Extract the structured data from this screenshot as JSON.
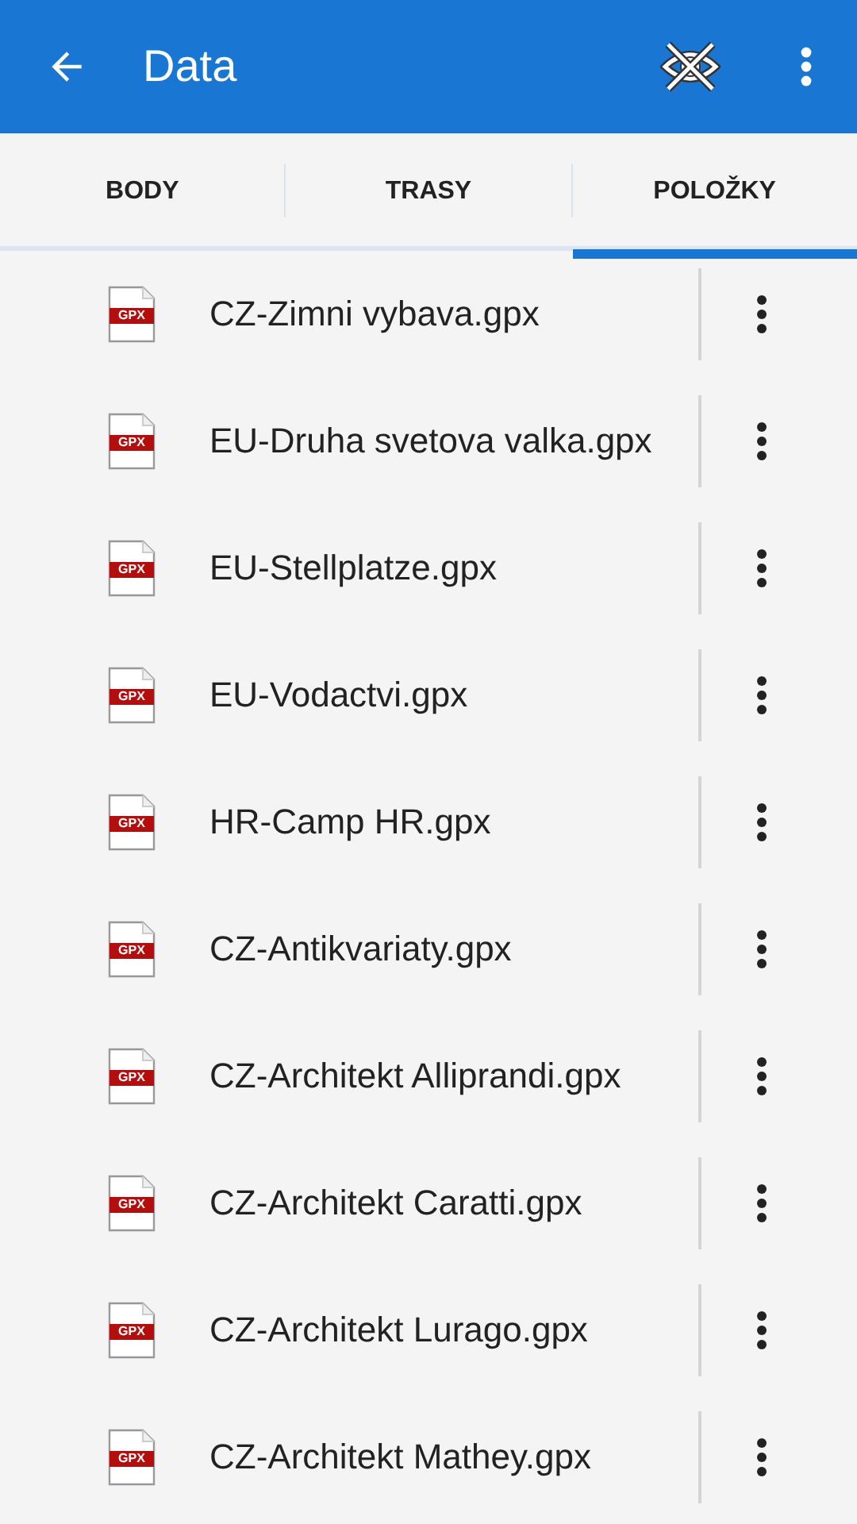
{
  "app_bar": {
    "title": "Data"
  },
  "tabs": [
    {
      "label": "BODY",
      "selected": false
    },
    {
      "label": "TRASY",
      "selected": false
    },
    {
      "label": "POLOŽKY",
      "selected": true
    }
  ],
  "files": [
    {
      "name": "CZ-Zimni vybava.gpx",
      "badge": "GPX"
    },
    {
      "name": "EU-Druha svetova valka.gpx",
      "badge": "GPX"
    },
    {
      "name": "EU-Stellplatze.gpx",
      "badge": "GPX"
    },
    {
      "name": "EU-Vodactvi.gpx",
      "badge": "GPX"
    },
    {
      "name": "HR-Camp HR.gpx",
      "badge": "GPX"
    },
    {
      "name": "CZ-Antikvariaty.gpx",
      "badge": "GPX"
    },
    {
      "name": "CZ-Architekt Alliprandi.gpx",
      "badge": "GPX"
    },
    {
      "name": "CZ-Architekt Caratti.gpx",
      "badge": "GPX"
    },
    {
      "name": "CZ-Architekt Lurago.gpx",
      "badge": "GPX"
    },
    {
      "name": "CZ-Architekt Mathey.gpx",
      "badge": "GPX"
    }
  ]
}
